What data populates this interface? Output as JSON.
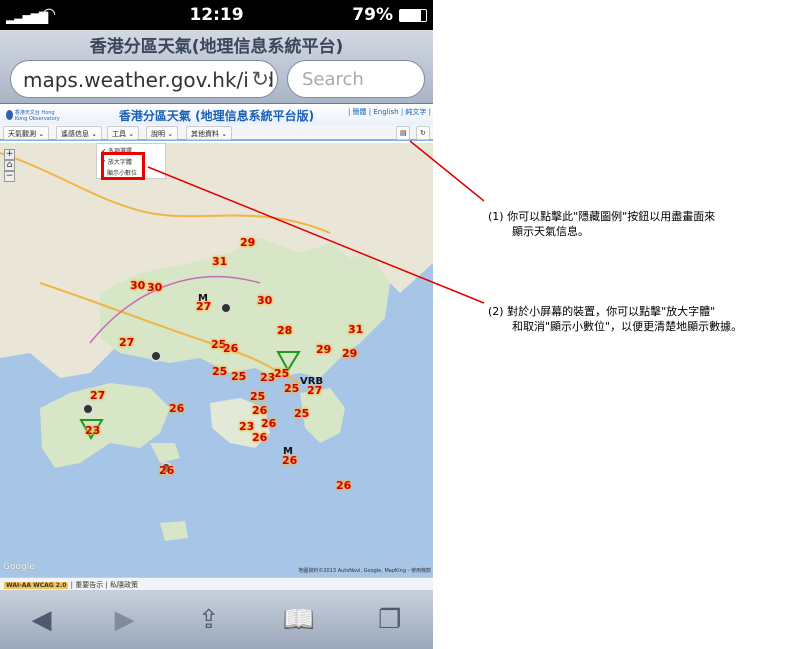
{
  "status_bar": {
    "time": "12:19",
    "battery": "79%",
    "signal_icon": "signal-bars-icon",
    "wifi_icon": "wifi-icon"
  },
  "browser": {
    "page_title": "香港分區天氣(地理信息系統平台)",
    "url": "maps.weather.gov.hk/ind",
    "search_placeholder": "Search"
  },
  "site": {
    "logo_text": "香港天文台 Hong Kong Observatory",
    "title": "香港分區天氣 (地理信息系統平台版)",
    "languages": "| 簡體 | English | 純文字 |",
    "menus": [
      "天氣觀測 ⌄",
      "遙感信息 ⌄",
      "工具 ⌄",
      "說明 ⌄",
      "其他資料 ⌄"
    ],
    "dropdown": [
      "✔ 多項選擇",
      "✔ 放大字體",
      "顯示小數位"
    ],
    "hide_legend_icon": "legend-icon",
    "refresh_icon": "refresh-icon",
    "zoom": [
      "+",
      "⌂",
      "−"
    ]
  },
  "map": {
    "temperatures": [
      "29",
      "31",
      "30",
      "30",
      "27",
      "30",
      "28",
      "31",
      "27",
      "25",
      "26",
      "29",
      "29",
      "25",
      "25",
      "25",
      "23",
      "25",
      "27",
      "27",
      "26",
      "25",
      "26",
      "25",
      "23",
      "26",
      "23",
      "26",
      "26",
      "26",
      "26"
    ],
    "wind_labels": [
      "M",
      "VRB",
      "M"
    ],
    "google": "Google",
    "copyright": "地圖資料©2013 AutoNavi, Google, MapKing - 使用條款"
  },
  "footer": {
    "badge": "WAI-AA WCAG 2.0",
    "links": "| 重要告示 | 私隱政策"
  },
  "bottom_bar": {
    "back": "◀",
    "forward": "▶",
    "share": "⇪",
    "bookmarks": "📖",
    "tabs": "❐"
  },
  "annotations": [
    {
      "line1": "(1)  你可以點擊此\"隱藏圖例\"按鈕以用盡畫面來",
      "line2": "顯示天氣信息。"
    },
    {
      "line1": "(2)  對於小屏幕的裝置，你可以點擊\"放大字體\"",
      "line2": "和取消\"顯示小數位\"，以便更清楚地顯示數據。"
    }
  ],
  "colors": {
    "annotation_line": "#e00000",
    "sea": "#a7c5e6",
    "land": "#dce8d0",
    "temperature": "#cc0000"
  }
}
